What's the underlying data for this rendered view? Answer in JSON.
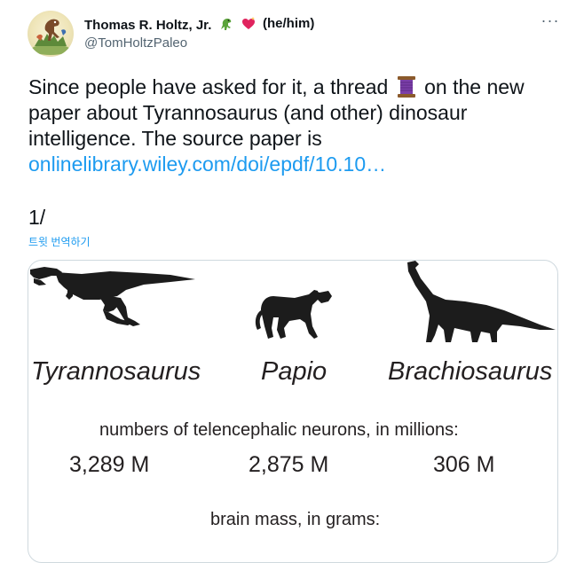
{
  "author": {
    "name": "Thomas R. Holtz, Jr.",
    "pronouns": "(he/him)",
    "handle": "@TomHoltzPaleo",
    "name_emojis": [
      "t-rex-emoji",
      "sparkling-heart-emoji"
    ]
  },
  "actions": {
    "more_label": "···"
  },
  "tweet": {
    "text_part1": "Since people have asked for it, a thread",
    "text_part2": " on the new paper about Tyrannosaurus (and other) dinosaur intelligence. The source paper is",
    "link_text": "onlinelibrary.wiley.com/doi/epdf/10.10…",
    "thread_number": "1/",
    "translate_label": "트윗 번역하기",
    "inline_emoji": "thread-spool-emoji"
  },
  "figure": {
    "species": [
      "Tyrannosaurus",
      "Papio",
      "Brachiosaurus"
    ],
    "silhouettes": [
      "tyrannosaurus-silhouette",
      "baboon-silhouette",
      "brachiosaurus-silhouette"
    ],
    "neurons_heading": "numbers of telencephalic neurons, in millions:",
    "neuron_values": [
      "3,289 M",
      "2,875 M",
      "306 M"
    ],
    "brain_mass_heading": "brain mass, in grams:"
  },
  "colors": {
    "text": "#0f1419",
    "secondary": "#536471",
    "link": "#1d9bf0",
    "border": "#cfd9de",
    "silhouette": "#1c1c1c"
  }
}
